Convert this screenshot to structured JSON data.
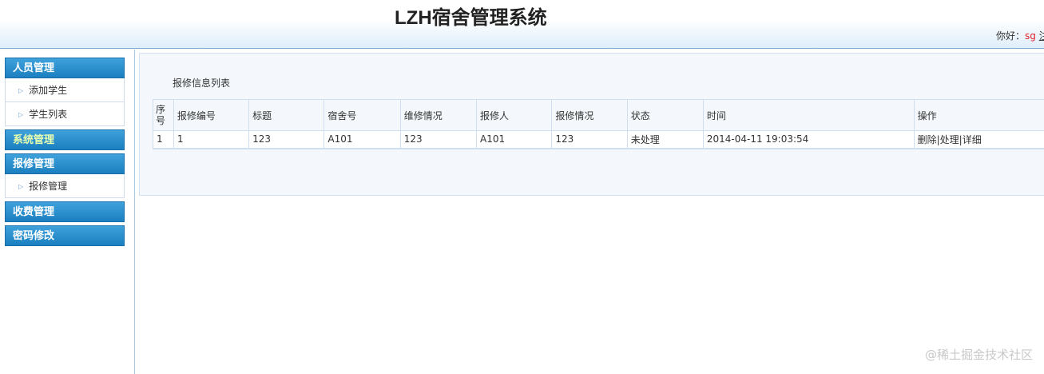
{
  "header": {
    "title": "LZH宿舍管理系统",
    "greeting": "你好：",
    "user": "sg",
    "logout": "注销"
  },
  "sidebar": {
    "groups": [
      {
        "label": "人员管理",
        "items": [
          "添加学生",
          "学生列表"
        ]
      },
      {
        "label": "系统管理",
        "items": []
      },
      {
        "label": "报修管理",
        "items": [
          "报修管理"
        ]
      },
      {
        "label": "收费管理",
        "items": []
      },
      {
        "label": "密码修改",
        "items": []
      }
    ]
  },
  "main": {
    "caption": "报修信息列表",
    "columns": [
      "序号",
      "报修编号",
      "标题",
      "宿舍号",
      "维修情况",
      "报修人",
      "报修情况",
      "状态",
      "时间",
      "操作"
    ],
    "rows": [
      {
        "cells": [
          "1",
          "1",
          "123",
          "A101",
          "123",
          "A101",
          "123",
          "未处理",
          "2014-04-11 19:03:54"
        ],
        "actions": [
          "删除",
          "处理",
          "详细"
        ]
      }
    ]
  },
  "watermark": "@稀土掘金技术社区"
}
